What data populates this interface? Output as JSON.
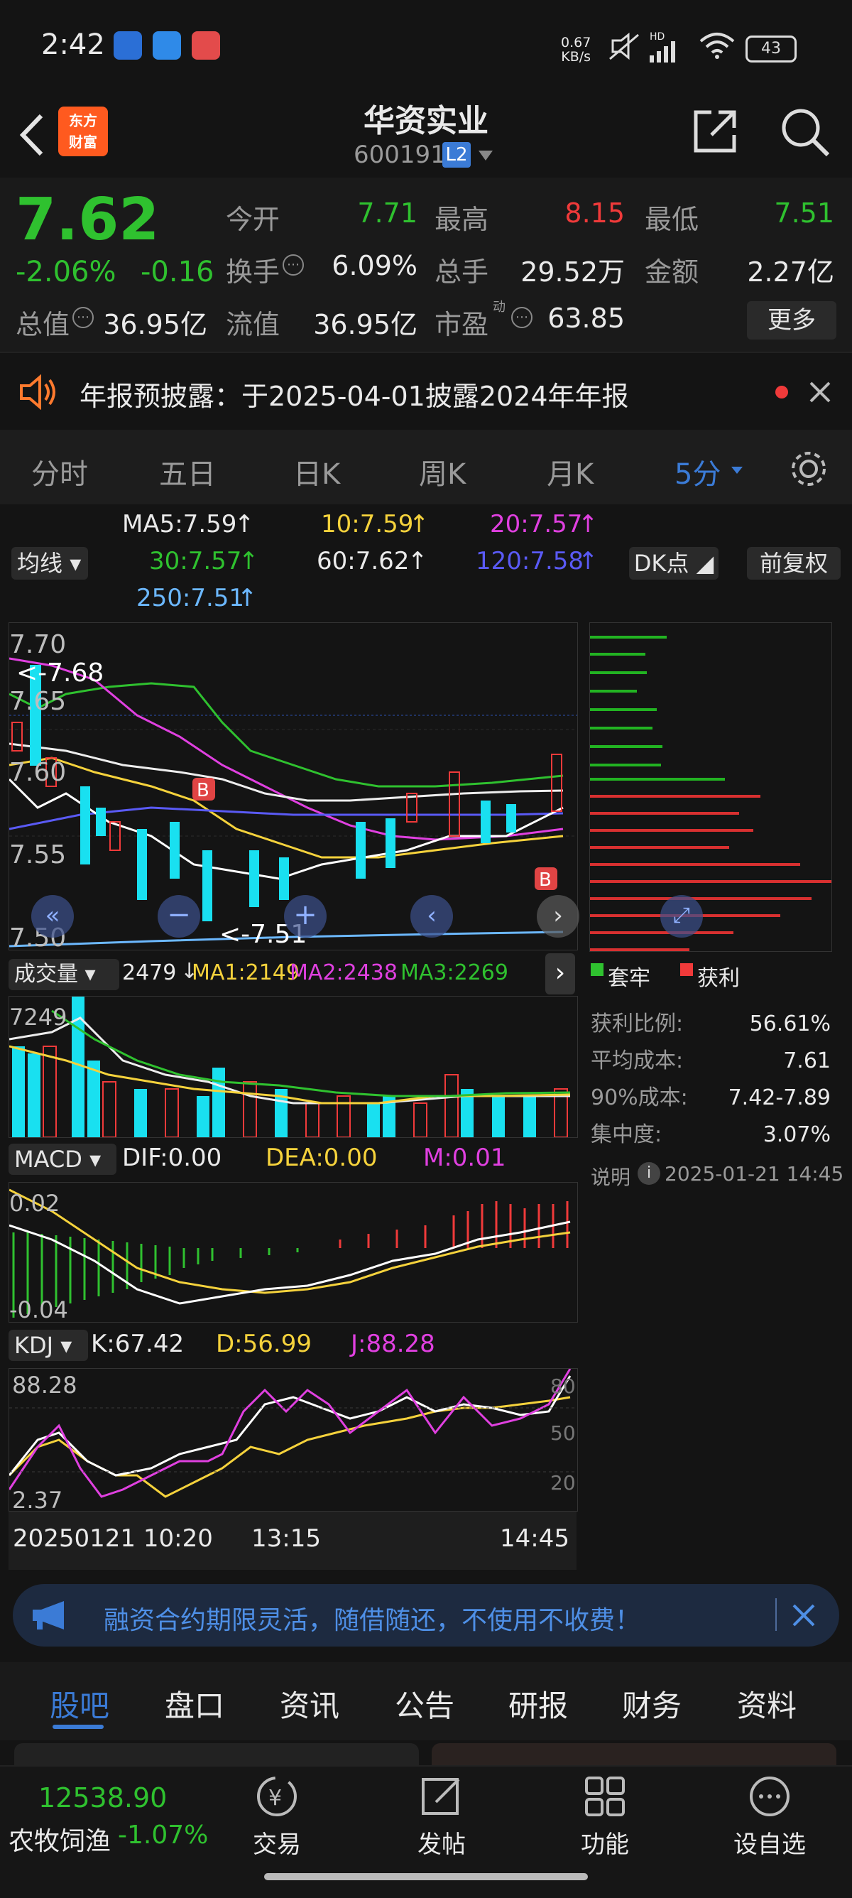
{
  "status_bar": {
    "time": "2:42",
    "net_speed_top": "0.67",
    "net_speed_bottom": "KB/s",
    "battery": "43",
    "hd": "HD"
  },
  "header": {
    "logo_line1": "东方",
    "logo_line2": "财富",
    "title": "华资实业",
    "code": "600191",
    "level_badge": "L2"
  },
  "quote": {
    "price": "7.62",
    "change_pct": "-2.06%",
    "change": "-0.16",
    "open_label": "今开",
    "open": "7.71",
    "high_label": "最高",
    "high": "8.15",
    "low_label": "最低",
    "low": "7.51",
    "turnover_label": "换手",
    "turnover": "6.09%",
    "volume_label": "总手",
    "volume": "29.52万",
    "amount_label": "金额",
    "amount": "2.27亿",
    "mktcap_label": "总值",
    "mktcap": "36.95亿",
    "float_label": "流值",
    "float": "36.95亿",
    "pe_label": "市盈",
    "pe_sup": "动",
    "pe": "63.85",
    "more_button": "更多"
  },
  "notice": {
    "text": "年报预披露：于2025-04-01披露2024年年报"
  },
  "chart_tabs": {
    "items": [
      "分时",
      "五日",
      "日K",
      "周K",
      "月K",
      "5分"
    ],
    "active": "5分"
  },
  "ma_legend": {
    "selector": "均线",
    "ma5": "MA5:7.59",
    "ma10": "10:7.59",
    "ma20": "20:7.57",
    "ma30": "30:7.57",
    "ma60": "60:7.62",
    "ma120": "120:7.58",
    "ma250": "250:7.51",
    "dk_button": "DK点",
    "adjust_button": "前复权"
  },
  "main_chart": {
    "y_top": "7.70",
    "y_2": "7.65",
    "y_3": "7.60",
    "y_4": "7.55",
    "y_bottom": "7.50",
    "high_marker": "<-7.68",
    "low_marker": "<-7.51",
    "buy_badge": "B"
  },
  "chip": {
    "legend_trapped": "套牢",
    "legend_profit": "获利",
    "rows": [
      {
        "label": "获利比例:",
        "value": "56.61%"
      },
      {
        "label": "平均成本:",
        "value": "7.61"
      },
      {
        "label": "90%成本:",
        "value": "7.42-7.89"
      },
      {
        "label": "集中度:",
        "value": "3.07%"
      }
    ],
    "note_label": "说明",
    "date": "2025-01-21 14:45"
  },
  "volume_panel": {
    "selector": "成交量",
    "vol": "2479",
    "ma1": "MA1:2149",
    "ma2": "MA2:2438",
    "ma3": "MA3:2269",
    "y_top": "7249"
  },
  "macd_panel": {
    "selector": "MACD",
    "dif": "DIF:0.00",
    "dea": "DEA:0.00",
    "m": "M:0.01",
    "y_top": "0.02",
    "y_bottom": "-0.04"
  },
  "kdj_panel": {
    "selector": "KDJ",
    "k": "K:67.42",
    "d": "D:56.99",
    "j": "J:88.28",
    "y_top": "88.28",
    "y_bottom": "2.37",
    "r80": "80",
    "r50": "50",
    "r20": "20"
  },
  "time_axis": {
    "start": "20250121 10:20",
    "mid": "13:15",
    "end": "14:45"
  },
  "ad_banner": {
    "text": "融资合约期限灵活，随借随还，不使用不收费！"
  },
  "section_tabs": {
    "items": [
      "股吧",
      "盘口",
      "资讯",
      "公告",
      "研报",
      "财务",
      "资料"
    ],
    "active": "股吧"
  },
  "bottom_nav": {
    "index_value": "12538.90",
    "index_name": "农牧饲渔",
    "index_change": "-1.07%",
    "items": [
      {
        "label": "交易",
        "icon": "trade-icon"
      },
      {
        "label": "发帖",
        "icon": "post-icon"
      },
      {
        "label": "功能",
        "icon": "grid-icon"
      },
      {
        "label": "设自选",
        "icon": "more-icon"
      }
    ]
  },
  "colors": {
    "up": "#f03a3a",
    "down": "#2fc12f",
    "accent": "#3b7bd6",
    "bg": "#141414"
  }
}
